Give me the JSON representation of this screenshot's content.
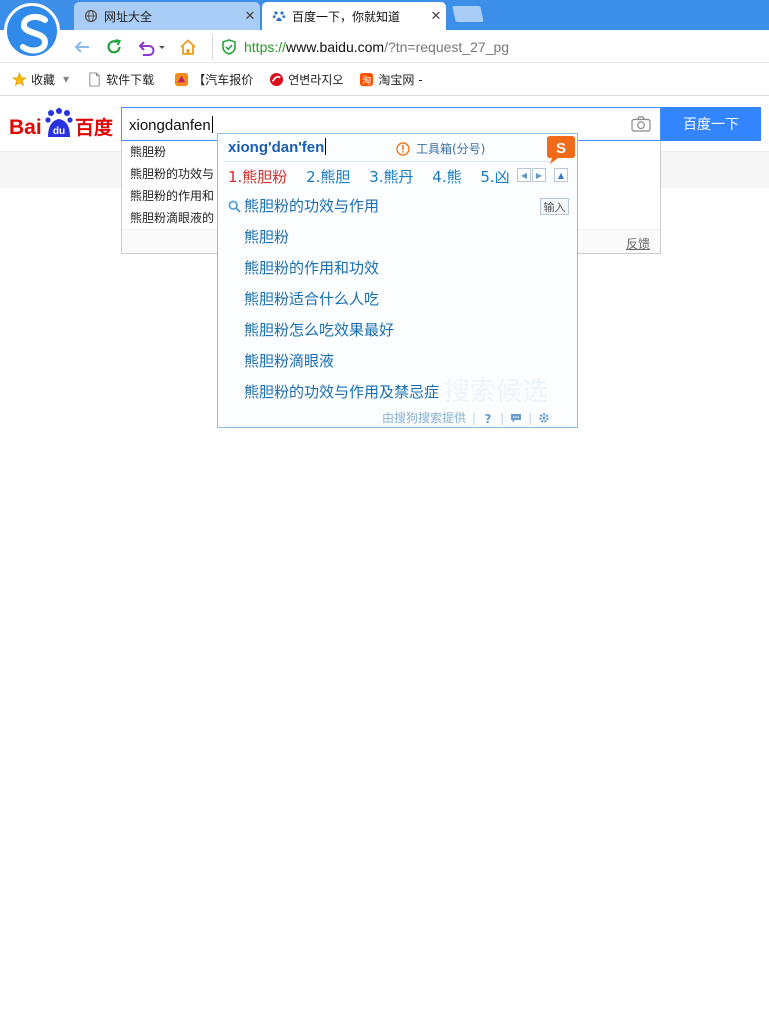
{
  "browser": {
    "tabs": [
      {
        "label": "网址大全",
        "close": "✕"
      },
      {
        "label": "百度一下，你就知道",
        "close": "✕"
      }
    ],
    "url": {
      "protocol": "https://",
      "host": "www.baidu.com",
      "path": "/?tn=request_27_pg"
    },
    "bookmarks": [
      {
        "label": "收藏",
        "icon": "star-icon"
      },
      {
        "label": "软件下载",
        "icon": "document-icon"
      },
      {
        "label": "【汽车报价",
        "icon": "car-price-icon"
      },
      {
        "label": "연변라지오",
        "icon": "radio-icon"
      },
      {
        "label": "淘宝网 -",
        "icon": "taobao-icon"
      }
    ]
  },
  "baidu": {
    "logo_text": "Bai百度",
    "search_value": "xiongdanfen",
    "search_button": "百度一下",
    "suggestions": [
      "熊胆粉",
      "熊胆粉的功效与",
      "熊胆粉的作用和",
      "熊胆粉滴眼液的"
    ],
    "feedback": "反馈"
  },
  "ime": {
    "composition": "xiong'dan'fen",
    "toolbox": "工具箱(分号)",
    "candidates": [
      "1.熊胆粉",
      "2.熊胆",
      "3.熊丹",
      "4.熊",
      "5.凶"
    ],
    "enter_label": "输入",
    "suggestions": [
      "熊胆粉的功效与作用",
      "熊胆粉",
      "熊胆粉的作用和功效",
      "熊胆粉适合什么人吃",
      "熊胆粉怎么吃效果最好",
      "熊胆粉滴眼液",
      "熊胆粉的功效与作用及禁忌症"
    ],
    "watermark": "搜索候选",
    "footer": "由搜狗搜索提供"
  },
  "colors": {
    "tabbar": "#3c8fe9",
    "baidu_blue": "#3385ff",
    "baidu_red": "#e10602",
    "ime_blue": "#1a6fb0",
    "ime_red": "#d0302a"
  }
}
